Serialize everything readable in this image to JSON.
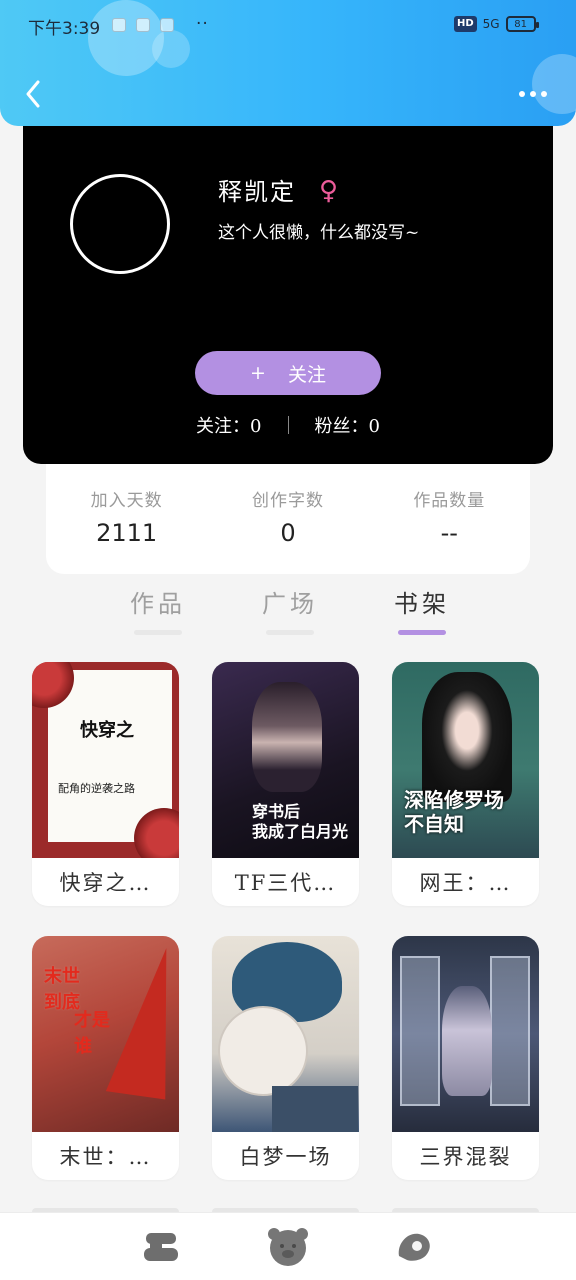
{
  "status_bar": {
    "time": "下午3:39",
    "dots": "··",
    "hd": "HD",
    "signal": "5G",
    "battery": "81"
  },
  "header": {
    "back_icon": "chevron-left-icon",
    "more_icon": "more-horizontal-icon"
  },
  "profile": {
    "username": "释凯定",
    "gender_icon": "♀",
    "bio": "这个人很懒，什么都没写~",
    "follow_plus": "+",
    "follow_label": "关注",
    "following_label": "关注：",
    "following_count": "0",
    "followers_label": "粉丝：",
    "followers_count": "0",
    "accent_color": "#b390e2"
  },
  "stats": [
    {
      "label": "加入天数",
      "value": "2111"
    },
    {
      "label": "创作字数",
      "value": "0"
    },
    {
      "label": "作品数量",
      "value": "--"
    }
  ],
  "tabs": [
    {
      "label": "作品",
      "active": false
    },
    {
      "label": "广场",
      "active": false
    },
    {
      "label": "书架",
      "active": true
    }
  ],
  "books": [
    {
      "title": "快穿之…",
      "cover_title": "快穿之",
      "cover_subtitle": "配角的逆袭之路"
    },
    {
      "title": "TF三代…",
      "cover_title": "穿书后\n我成了白月光"
    },
    {
      "title": "网王：…",
      "cover_title": "深陷修罗场\n不自知"
    },
    {
      "title": "末世：…",
      "cover_title": "末世\n到底",
      "cover_title2": "才是\n谁"
    },
    {
      "title": "白梦一场"
    },
    {
      "title": "三界混裂"
    }
  ],
  "bottom_nav": [
    {
      "icon": "home-icon"
    },
    {
      "icon": "bear-avatar-icon"
    },
    {
      "icon": "profile-icon"
    }
  ]
}
